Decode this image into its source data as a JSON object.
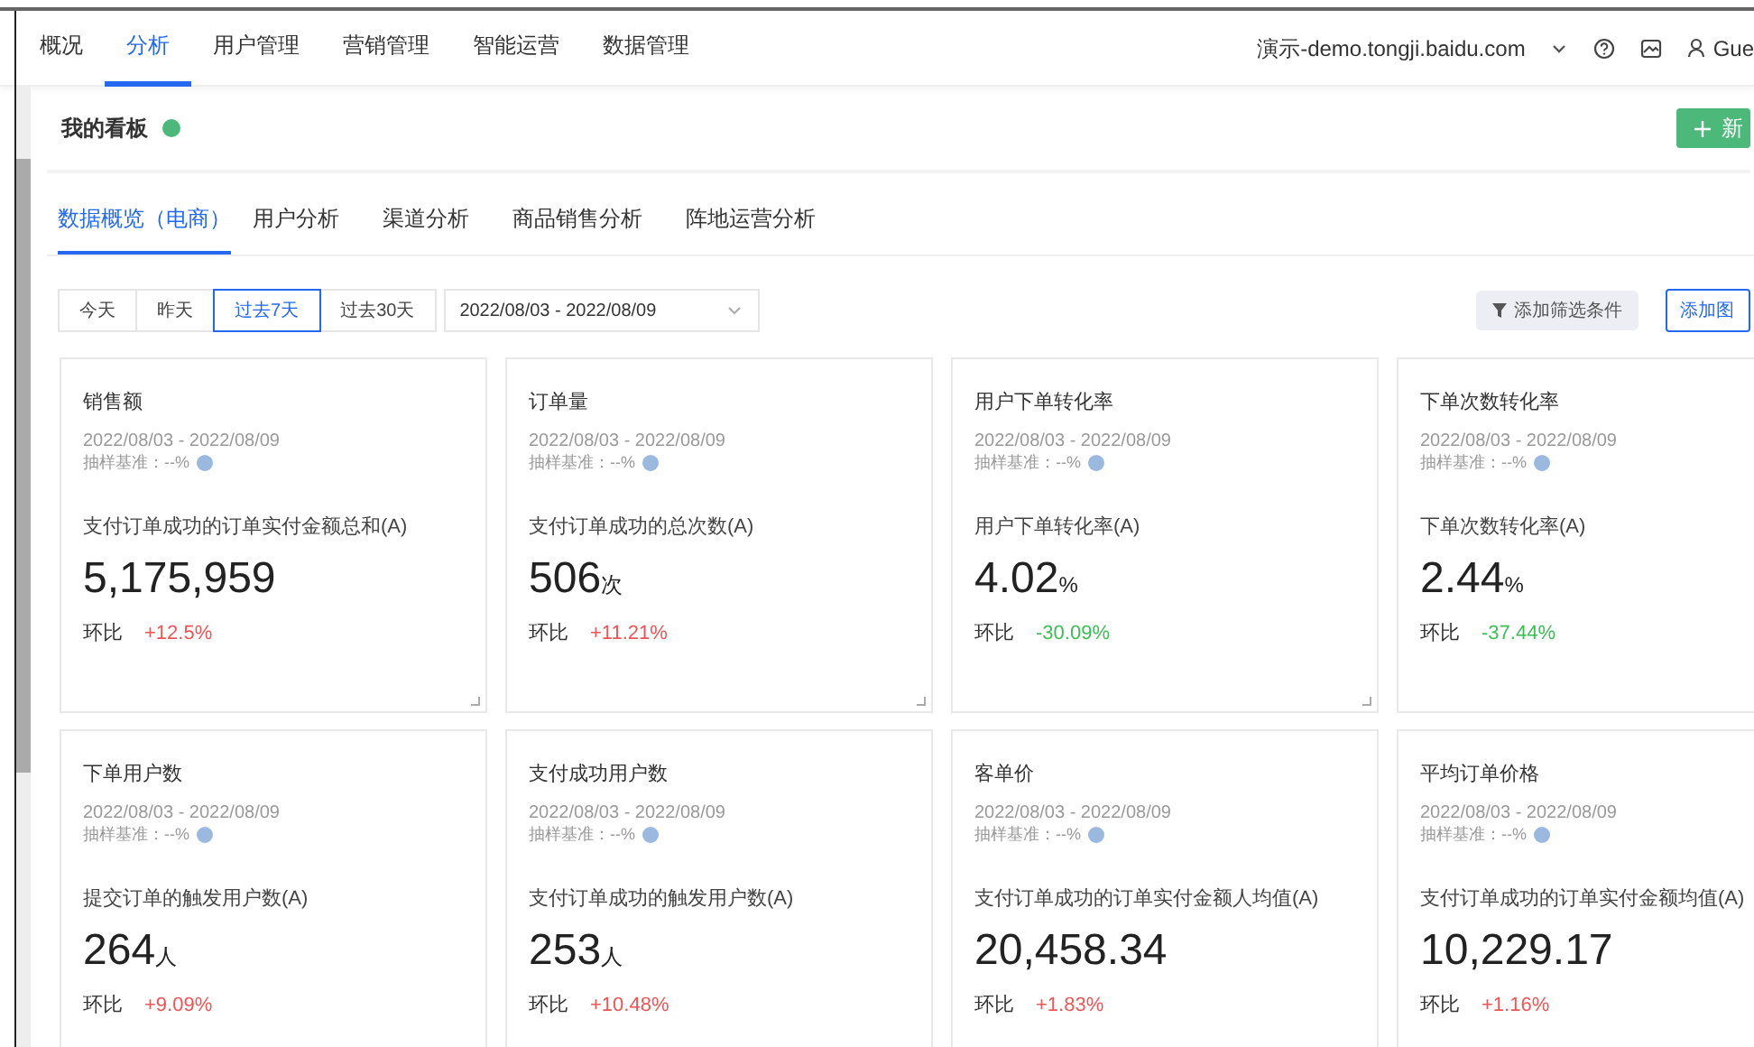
{
  "nav": {
    "items": [
      {
        "label": "概况",
        "selected": false
      },
      {
        "label": "分析",
        "selected": true
      },
      {
        "label": "用户管理",
        "selected": false
      },
      {
        "label": "营销管理",
        "selected": false
      },
      {
        "label": "智能运营",
        "selected": false
      },
      {
        "label": "数据管理",
        "selected": false
      }
    ],
    "site": "演示-demo.tongji.baidu.com",
    "user": "Gue"
  },
  "board": {
    "title": "我的看板",
    "new_button": "新"
  },
  "tabs": [
    {
      "label": "数据概览（电商）",
      "selected": true
    },
    {
      "label": "用户分析",
      "selected": false
    },
    {
      "label": "渠道分析",
      "selected": false
    },
    {
      "label": "商品销售分析",
      "selected": false
    },
    {
      "label": "阵地运营分析",
      "selected": false
    }
  ],
  "date_buttons": [
    {
      "label": "今天",
      "selected": false
    },
    {
      "label": "昨天",
      "selected": false
    },
    {
      "label": "过去7天",
      "selected": true
    },
    {
      "label": "过去30天",
      "selected": false
    }
  ],
  "date_range": "2022/08/03 - 2022/08/09",
  "filter_button": "添加筛选条件",
  "add_chart_button": "添加图",
  "cards": [
    {
      "title": "销售额",
      "date": "2022/08/03 - 2022/08/09",
      "sampling": "抽样基准：--%",
      "metric": "支付订单成功的订单实付金额总和(A)",
      "value": "5,175,959",
      "change_label": "环比",
      "change": "+12.5%",
      "color": "#f05454"
    },
    {
      "title": "订单量",
      "date": "2022/08/03 - 2022/08/09",
      "sampling": "抽样基准：--%",
      "metric": "支付订单成功的总次数(A)",
      "value": "506",
      "unit": "次",
      "change_label": "环比",
      "change": "+11.21%",
      "color": "#f05454"
    },
    {
      "title": "用户下单转化率",
      "date": "2022/08/03 - 2022/08/09",
      "sampling": "抽样基准：--%",
      "metric": "用户下单转化率(A)",
      "value": "4.02",
      "unit": "%",
      "change_label": "环比",
      "change": "-30.09%",
      "color": "#3cbe55"
    },
    {
      "title": "下单次数转化率",
      "date": "2022/08/03 - 2022/08/09",
      "sampling": "抽样基准：--%",
      "metric": "下单次数转化率(A)",
      "value": "2.44",
      "unit": "%",
      "change_label": "环比",
      "change": "-37.44%",
      "color": "#3cbe55"
    },
    {
      "title": "下单用户数",
      "date": "2022/08/03 - 2022/08/09",
      "sampling": "抽样基准：--%",
      "metric": "提交订单的触发用户数(A)",
      "value": "264",
      "unit": "人",
      "change_label": "环比",
      "change": "+9.09%",
      "color": "#f05454"
    },
    {
      "title": "支付成功用户数",
      "date": "2022/08/03 - 2022/08/09",
      "sampling": "抽样基准：--%",
      "metric": "支付订单成功的触发用户数(A)",
      "value": "253",
      "unit": "人",
      "change_label": "环比",
      "change": "+10.48%",
      "color": "#f05454"
    },
    {
      "title": "客单价",
      "date": "2022/08/03 - 2022/08/09",
      "sampling": "抽样基准：--%",
      "metric": "支付订单成功的订单实付金额人均值(A)",
      "value": "20,458.34",
      "change_label": "环比",
      "change": "+1.83%",
      "color": "#f05454"
    },
    {
      "title": "平均订单价格",
      "date": "2022/08/03 - 2022/08/09",
      "sampling": "抽样基准：--%",
      "metric": "支付订单成功的订单实付金额均值(A)",
      "value": "10,229.17",
      "change_label": "环比",
      "change": "+1.16%",
      "color": "#f05454"
    }
  ]
}
